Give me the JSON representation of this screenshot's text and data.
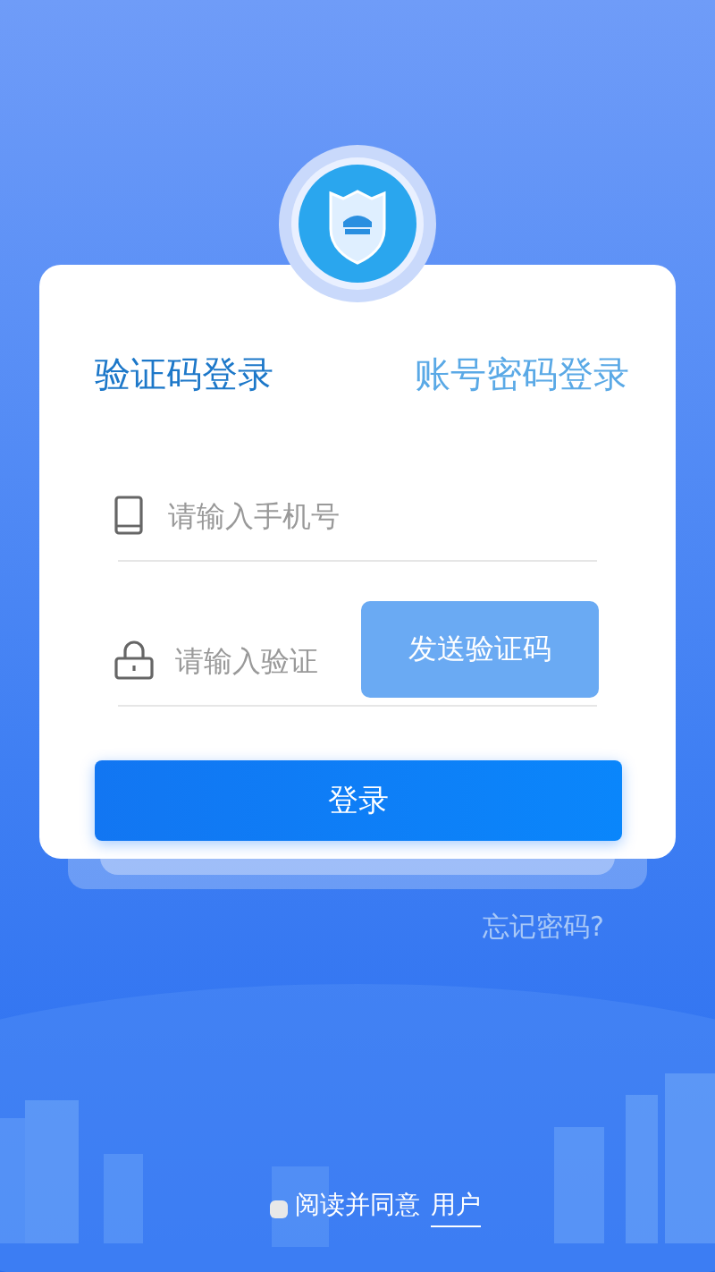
{
  "tabs": [
    {
      "label": "验证码登录",
      "selected": true
    },
    {
      "label": "账号密码登录",
      "selected": false
    }
  ],
  "phone": {
    "placeholder": "请输入手机号"
  },
  "code": {
    "placeholder": "请输入验证"
  },
  "send_button": "发送验证码",
  "login_button": "登录",
  "forgot_link": "忘记密码?",
  "agreement": {
    "checked": false,
    "text": "阅读并同意",
    "link": "用户"
  }
}
